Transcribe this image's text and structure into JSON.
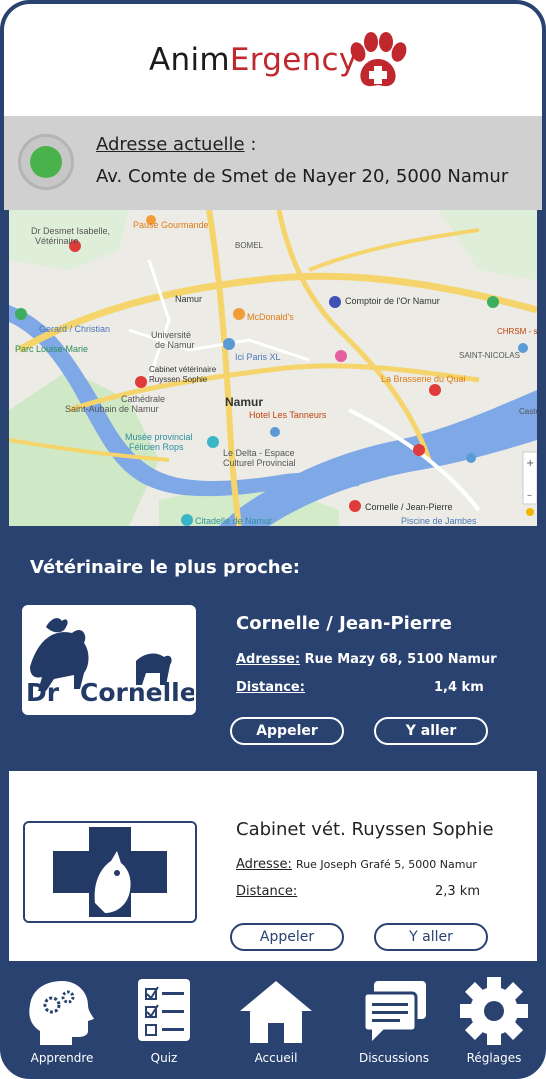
{
  "header": {
    "logo_part1": "Anim",
    "logo_part2": "Ergency"
  },
  "location": {
    "label": "Adresse actuelle",
    "colon": " :",
    "value": "Av. Comte de Smet de Nayer 20, 5000 Namur",
    "status_color": "#4ab24a"
  },
  "map": {
    "labels": [
      "Dr Desmet Isabelle,",
      "Vétérinaire",
      "Pause Gourmande",
      "Cabinet vétérinaire",
      "Ruyssen Sophie",
      "Namur",
      "McDonald's",
      "Université",
      "de Namur",
      "Comptoir de l'Or Namur",
      "Ici Paris XL",
      "Hotel Les Tanneurs",
      "Cathédrale",
      "Saint-Aubain de Namur",
      "Musée provincial",
      "Félicien Rops",
      "Le Delta - Espace",
      "Culturel Provincial",
      "La Brasserie du Quai",
      "CHRSM - site Sainte-Élisabeth",
      "Cornelle / Jean-Pierre",
      "Citadelle de Namur",
      "Parc Louise-Marie",
      "Gerard / Christian",
      "Piscine de Jambes",
      "SAINT-NICOLAS",
      "BOMEL",
      "Caste"
    ]
  },
  "nearest": {
    "title": "Vétérinaire le plus proche:"
  },
  "vets": [
    {
      "name": "Cornelle / Jean-Pierre",
      "logo_text_1": "Dr",
      "logo_text_2": "Cornelle",
      "address_label": "Adresse:",
      "address": "Rue Mazy 68, 5100 Namur",
      "distance_label": "Distance:",
      "distance": "1,4 km",
      "call_label": "Appeler",
      "go_label": "Y aller"
    },
    {
      "name": "Cabinet vét. Ruyssen Sophie",
      "address_label": "Adresse:",
      "address": "Rue Joseph Grafé 5, 5000 Namur",
      "distance_label": "Distance:",
      "distance": "2,3 km",
      "call_label": "Appeler",
      "go_label": "Y aller"
    }
  ],
  "nav": [
    {
      "label": "Apprendre",
      "icon": "brain-gears-icon"
    },
    {
      "label": "Quiz",
      "icon": "checklist-icon"
    },
    {
      "label": "Accueil",
      "icon": "home-icon"
    },
    {
      "label": "Discussions",
      "icon": "chat-icon"
    },
    {
      "label": "Réglages",
      "icon": "gear-icon"
    }
  ],
  "colors": {
    "primary": "#2a4270",
    "accent_red": "#c0282d",
    "map_water": "#7ea8e6",
    "map_road": "#f5d56b"
  }
}
